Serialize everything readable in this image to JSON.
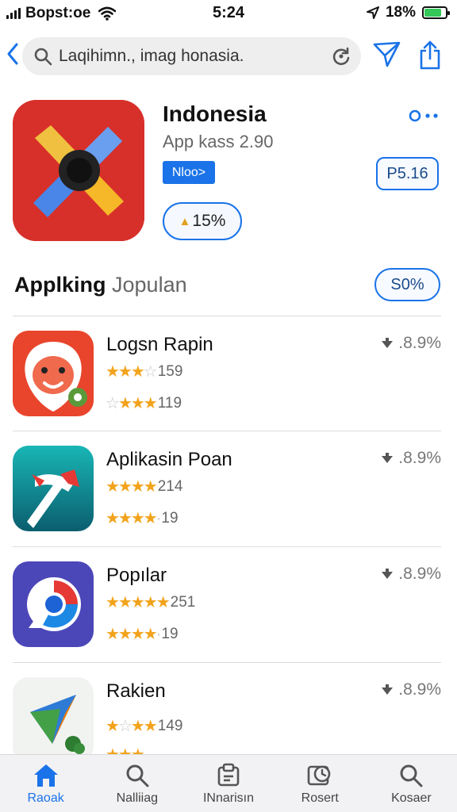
{
  "status_bar": {
    "carrier": "Bopst:oe",
    "time": "5:24",
    "battery": "18%",
    "battery_color": "#34c759"
  },
  "search": {
    "placeholder": "Laqihimn., imag honasia."
  },
  "featured": {
    "title": "Indonesia",
    "subtitle": "App kass 2.90",
    "small_button": "Nloo>",
    "rating": "15%",
    "price": "P5.16"
  },
  "section": {
    "title_bold": "Applking",
    "title_light": "Jopulan",
    "pill": "S0%"
  },
  "apps": [
    {
      "name": "Logsn Rapin",
      "downloads": ".8.9%",
      "ratings": [
        {
          "stars": 3.5,
          "count": "159"
        },
        {
          "stars": 3.5,
          "count": "119"
        }
      ]
    },
    {
      "name": "Aplikasin Poan",
      "downloads": ".8.9%",
      "ratings": [
        {
          "stars": 4.5,
          "count": "214"
        },
        {
          "stars": 4.5,
          "count": "19"
        }
      ]
    },
    {
      "name": "Popılar",
      "downloads": ".8.9%",
      "ratings": [
        {
          "stars": 5,
          "count": "251"
        },
        {
          "stars": 4.5,
          "count": "19"
        }
      ]
    },
    {
      "name": "Rakien",
      "downloads": ".8.9%",
      "ratings": [
        {
          "stars": 4,
          "count": "149"
        },
        {
          "stars": 3,
          "count": ""
        }
      ]
    }
  ],
  "tabs": [
    {
      "label": "Raoak",
      "icon": "home-icon",
      "active": true
    },
    {
      "label": "Nalliiag",
      "icon": "search-icon"
    },
    {
      "label": "INnarisın",
      "icon": "notes-icon"
    },
    {
      "label": "Rosert",
      "icon": "history-icon"
    },
    {
      "label": "Kosaer",
      "icon": "search-icon"
    }
  ],
  "colors": {
    "accent": "#1a73e8",
    "star": "#f2a31b"
  }
}
